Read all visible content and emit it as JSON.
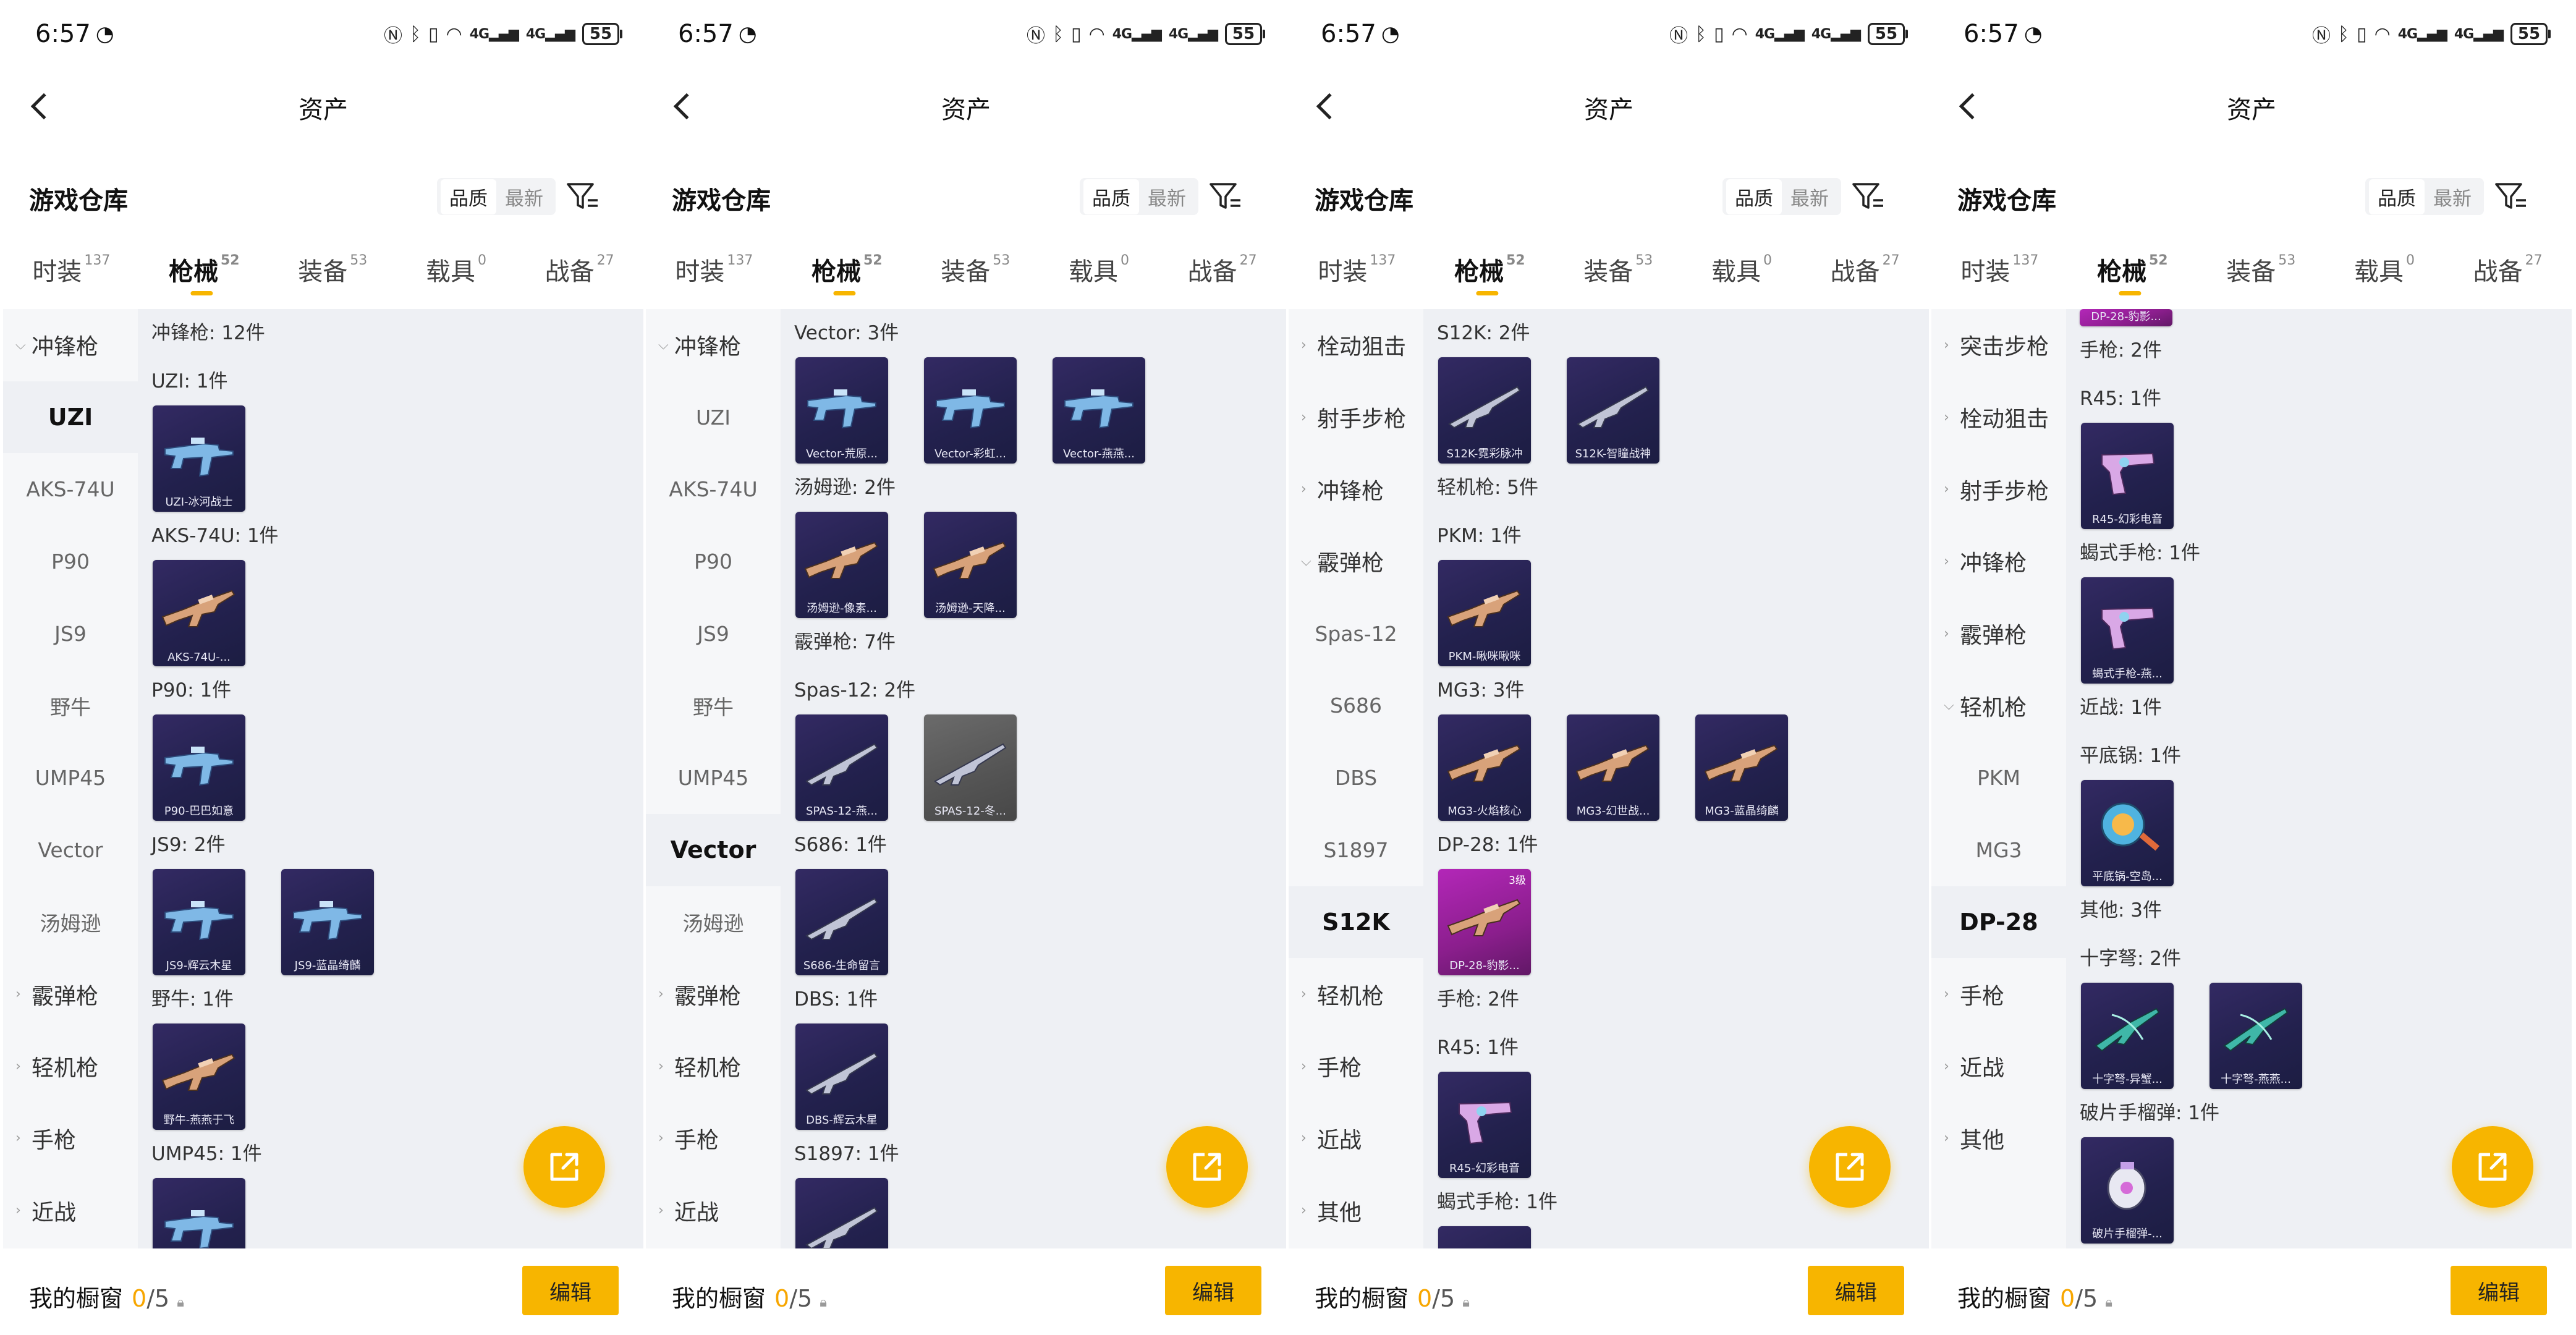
{
  "panels": [
    {
      "status": {
        "time": "6:57",
        "battery": "55"
      },
      "nav": {
        "title": "资产"
      },
      "warehouse": {
        "title": "游戏仓库",
        "sort": [
          "品质",
          "最新"
        ]
      },
      "tabs": [
        {
          "label": "时装",
          "count": "137"
        },
        {
          "label": "枪械",
          "count": "52"
        },
        {
          "label": "装备",
          "count": "53"
        },
        {
          "label": "载具",
          "count": "0"
        },
        {
          "label": "战备",
          "count": "27"
        }
      ],
      "sidebar": [
        {
          "label": "冲锋枪",
          "group": true,
          "open": true
        },
        {
          "label": "UZI",
          "selected": true
        },
        {
          "label": "AKS-74U"
        },
        {
          "label": "P90"
        },
        {
          "label": "JS9"
        },
        {
          "label": "野牛"
        },
        {
          "label": "UMP45"
        },
        {
          "label": "Vector"
        },
        {
          "label": "汤姆逊"
        },
        {
          "label": "霰弹枪",
          "group": true
        },
        {
          "label": "轻机枪",
          "group": true
        },
        {
          "label": "手枪",
          "group": true
        },
        {
          "label": "近战",
          "group": true
        }
      ],
      "rows": [
        {
          "label": "冲锋枪: 12件"
        },
        {
          "label": "UZI: 1件",
          "cards": [
            {
              "name": "UZI-冰河战士",
              "icon": "smg-icon"
            }
          ]
        },
        {
          "label": "AKS-74U: 1件",
          "cards": [
            {
              "name": "AKS-74U-...",
              "icon": "rifle-icon"
            }
          ]
        },
        {
          "label": "P90: 1件",
          "cards": [
            {
              "name": "P90-巴巴如意",
              "icon": "smg-icon"
            }
          ]
        },
        {
          "label": "JS9: 2件",
          "cards": [
            {
              "name": "JS9-辉云木星",
              "icon": "smg-icon"
            },
            {
              "name": "JS9-蓝晶绮麟",
              "icon": "smg-icon"
            }
          ]
        },
        {
          "label": "野牛: 1件",
          "cards": [
            {
              "name": "野牛-燕燕于飞",
              "icon": "rifle-icon"
            }
          ]
        },
        {
          "label": "UMP45: 1件",
          "cards": [
            {
              "name": "",
              "icon": "smg-icon"
            }
          ]
        }
      ],
      "bottom": {
        "title": "我的橱窗",
        "current": "0",
        "total": "/5",
        "edit": "编辑"
      }
    },
    {
      "status": {
        "time": "6:57",
        "battery": "55"
      },
      "nav": {
        "title": "资产"
      },
      "warehouse": {
        "title": "游戏仓库",
        "sort": [
          "品质",
          "最新"
        ]
      },
      "tabs": [
        {
          "label": "时装",
          "count": "137"
        },
        {
          "label": "枪械",
          "count": "52"
        },
        {
          "label": "装备",
          "count": "53"
        },
        {
          "label": "载具",
          "count": "0"
        },
        {
          "label": "战备",
          "count": "27"
        }
      ],
      "sidebar": [
        {
          "label": "冲锋枪",
          "group": true,
          "open": true
        },
        {
          "label": "UZI"
        },
        {
          "label": "AKS-74U"
        },
        {
          "label": "P90"
        },
        {
          "label": "JS9"
        },
        {
          "label": "野牛"
        },
        {
          "label": "UMP45"
        },
        {
          "label": "Vector",
          "selected": true
        },
        {
          "label": "汤姆逊"
        },
        {
          "label": "霰弹枪",
          "group": true
        },
        {
          "label": "轻机枪",
          "group": true
        },
        {
          "label": "手枪",
          "group": true
        },
        {
          "label": "近战",
          "group": true
        }
      ],
      "rows": [
        {
          "label": "Vector: 3件",
          "cards": [
            {
              "name": "Vector-荒原...",
              "icon": "smg-icon"
            },
            {
              "name": "Vector-彩虹...",
              "icon": "smg-icon"
            },
            {
              "name": "Vector-燕燕...",
              "icon": "smg-icon"
            }
          ]
        },
        {
          "label": "汤姆逊: 2件",
          "cards": [
            {
              "name": "汤姆逊-像素...",
              "icon": "rifle-icon"
            },
            {
              "name": "汤姆逊-天降...",
              "icon": "rifle-icon"
            }
          ]
        },
        {
          "label": "霰弹枪: 7件"
        },
        {
          "label": "Spas-12: 2件",
          "cards": [
            {
              "name": "SPAS-12-燕...",
              "icon": "shotgun-icon"
            },
            {
              "name": "SPAS-12-冬...",
              "icon": "shotgun-icon",
              "tone": "grey"
            }
          ]
        },
        {
          "label": "S686: 1件",
          "cards": [
            {
              "name": "S686-生命留言",
              "icon": "shotgun-icon"
            }
          ]
        },
        {
          "label": "DBS: 1件",
          "cards": [
            {
              "name": "DBS-辉云木星",
              "icon": "shotgun-icon"
            }
          ]
        },
        {
          "label": "S1897: 1件",
          "cards": [
            {
              "name": "",
              "icon": "shotgun-icon"
            }
          ]
        }
      ],
      "bottom": {
        "title": "我的橱窗",
        "current": "0",
        "total": "/5",
        "edit": "编辑"
      }
    },
    {
      "status": {
        "time": "6:57",
        "battery": "55"
      },
      "nav": {
        "title": "资产"
      },
      "warehouse": {
        "title": "游戏仓库",
        "sort": [
          "品质",
          "最新"
        ]
      },
      "tabs": [
        {
          "label": "时装",
          "count": "137"
        },
        {
          "label": "枪械",
          "count": "52"
        },
        {
          "label": "装备",
          "count": "53"
        },
        {
          "label": "载具",
          "count": "0"
        },
        {
          "label": "战备",
          "count": "27"
        }
      ],
      "sidebar": [
        {
          "label": "栓动狙击",
          "group": true
        },
        {
          "label": "射手步枪",
          "group": true
        },
        {
          "label": "冲锋枪",
          "group": true
        },
        {
          "label": "霰弹枪",
          "group": true,
          "open": true
        },
        {
          "label": "Spas-12"
        },
        {
          "label": "S686"
        },
        {
          "label": "DBS"
        },
        {
          "label": "S1897"
        },
        {
          "label": "S12K",
          "selected": true
        },
        {
          "label": "轻机枪",
          "group": true
        },
        {
          "label": "手枪",
          "group": true
        },
        {
          "label": "近战",
          "group": true
        },
        {
          "label": "其他",
          "group": true
        }
      ],
      "rows": [
        {
          "label": "S12K: 2件",
          "cards": [
            {
              "name": "S12K-霓彩脉冲",
              "icon": "shotgun-icon"
            },
            {
              "name": "S12K-智瞳战神",
              "icon": "shotgun-icon"
            }
          ]
        },
        {
          "label": "轻机枪: 5件"
        },
        {
          "label": "PKM: 1件",
          "cards": [
            {
              "name": "PKM-啾咪啾咪",
              "icon": "rifle-icon"
            }
          ]
        },
        {
          "label": "MG3: 3件",
          "cards": [
            {
              "name": "MG3-火焰核心",
              "icon": "rifle-icon"
            },
            {
              "name": "MG3-幻世战...",
              "icon": "rifle-icon"
            },
            {
              "name": "MG3-蓝晶绮麟",
              "icon": "rifle-icon"
            }
          ]
        },
        {
          "label": "DP-28: 1件",
          "cards": [
            {
              "name": "DP-28-豹影...",
              "icon": "rifle-icon",
              "tone": "pink",
              "level": "3级"
            }
          ]
        },
        {
          "label": "手枪: 2件"
        },
        {
          "label": "R45: 1件",
          "cards": [
            {
              "name": "R45-幻彩电音",
              "icon": "pistol-icon"
            }
          ]
        },
        {
          "label": "蝎式手枪: 1件",
          "cards": [
            {
              "name": "",
              "icon": "pistol-icon"
            }
          ]
        }
      ],
      "bottom": {
        "title": "我的橱窗",
        "current": "0",
        "total": "/5",
        "edit": "编辑"
      }
    },
    {
      "status": {
        "time": "6:57",
        "battery": "55"
      },
      "nav": {
        "title": "资产"
      },
      "warehouse": {
        "title": "游戏仓库",
        "sort": [
          "品质",
          "最新"
        ]
      },
      "tabs": [
        {
          "label": "时装",
          "count": "137"
        },
        {
          "label": "枪械",
          "count": "52"
        },
        {
          "label": "装备",
          "count": "53"
        },
        {
          "label": "载具",
          "count": "0"
        },
        {
          "label": "战备",
          "count": "27"
        }
      ],
      "sidebar": [
        {
          "label": "突击步枪",
          "group": true
        },
        {
          "label": "栓动狙击",
          "group": true
        },
        {
          "label": "射手步枪",
          "group": true
        },
        {
          "label": "冲锋枪",
          "group": true
        },
        {
          "label": "霰弹枪",
          "group": true
        },
        {
          "label": "轻机枪",
          "group": true,
          "open": true
        },
        {
          "label": "PKM"
        },
        {
          "label": "MG3"
        },
        {
          "label": "DP-28",
          "selected": true
        },
        {
          "label": "手枪",
          "group": true
        },
        {
          "label": "近战",
          "group": true
        },
        {
          "label": "其他",
          "group": true
        }
      ],
      "partial_card": {
        "name": "DP-28-豹影...",
        "tone": "pink"
      },
      "rows": [
        {
          "label": "手枪: 2件"
        },
        {
          "label": "R45: 1件",
          "cards": [
            {
              "name": "R45-幻彩电音",
              "icon": "pistol-icon"
            }
          ]
        },
        {
          "label": "蝎式手枪: 1件",
          "cards": [
            {
              "name": "蝎式手枪-燕...",
              "icon": "pistol-icon"
            }
          ]
        },
        {
          "label": "近战: 1件"
        },
        {
          "label": "平底锅: 1件",
          "cards": [
            {
              "name": "平底锅-空岛...",
              "icon": "pan-icon"
            }
          ]
        },
        {
          "label": "其他: 3件"
        },
        {
          "label": "十字弩: 2件",
          "cards": [
            {
              "name": "十字弩-异蟹...",
              "icon": "crossbow-icon"
            },
            {
              "name": "十字弩-燕燕...",
              "icon": "crossbow-icon"
            }
          ]
        },
        {
          "label": "破片手榴弹: 1件",
          "cards": [
            {
              "name": "破片手榴弹-...",
              "icon": "grenade-icon"
            }
          ]
        }
      ],
      "bottom": {
        "title": "我的橱窗",
        "current": "0",
        "total": "/5",
        "edit": "编辑"
      }
    }
  ]
}
